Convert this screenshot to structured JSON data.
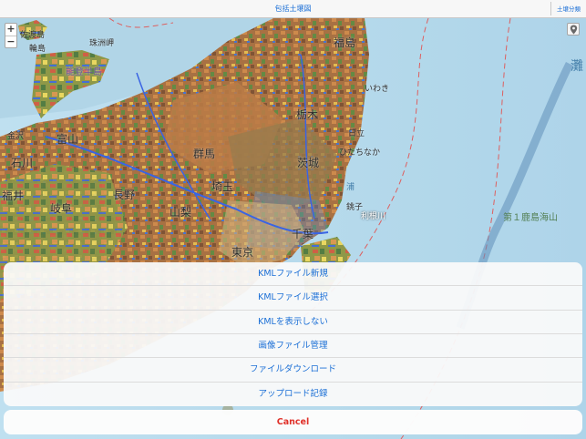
{
  "nav": {
    "title": "包括土壌図",
    "right_button": "土壌分類"
  },
  "map": {
    "zoom_in": "+",
    "zoom_out": "−",
    "labels": {
      "sado": "佐渡島",
      "noto": "能登半島",
      "wajima": "輪島",
      "suzu": "珠洲岬",
      "fukushima": "福島",
      "iwaki": "いわき",
      "tochigi": "栃木",
      "hitachi": "日立",
      "hitachinaka": "ひたちなか",
      "ibaraki": "茨城",
      "toyama": "富山",
      "ishikawa": "石川",
      "kanazawa": "金沢",
      "fukui": "福井",
      "gifu": "岐阜",
      "nagano": "長野",
      "yamanashi": "山梨",
      "saitama": "埼玉",
      "gunma": "群馬",
      "tokyo": "東京",
      "chiba": "千葉",
      "choshi": "銚子",
      "tonegawa": "利根川",
      "kashima_seamount": "第１鹿島海山",
      "nada": "灘",
      "ura": "浦"
    }
  },
  "action_sheet": {
    "items": [
      "KMLファイル新規",
      "KMLファイル選択",
      "KMLを表示しない",
      "画像ファイル管理",
      "ファイルダウンロード",
      "アップロード記録"
    ],
    "cancel": "Cancel"
  },
  "colors": {
    "accent": "#1b6fd6",
    "cancel": "#e0312a",
    "sea": "#a9d3e8"
  },
  "icons": {
    "location": "map-pin-icon"
  }
}
